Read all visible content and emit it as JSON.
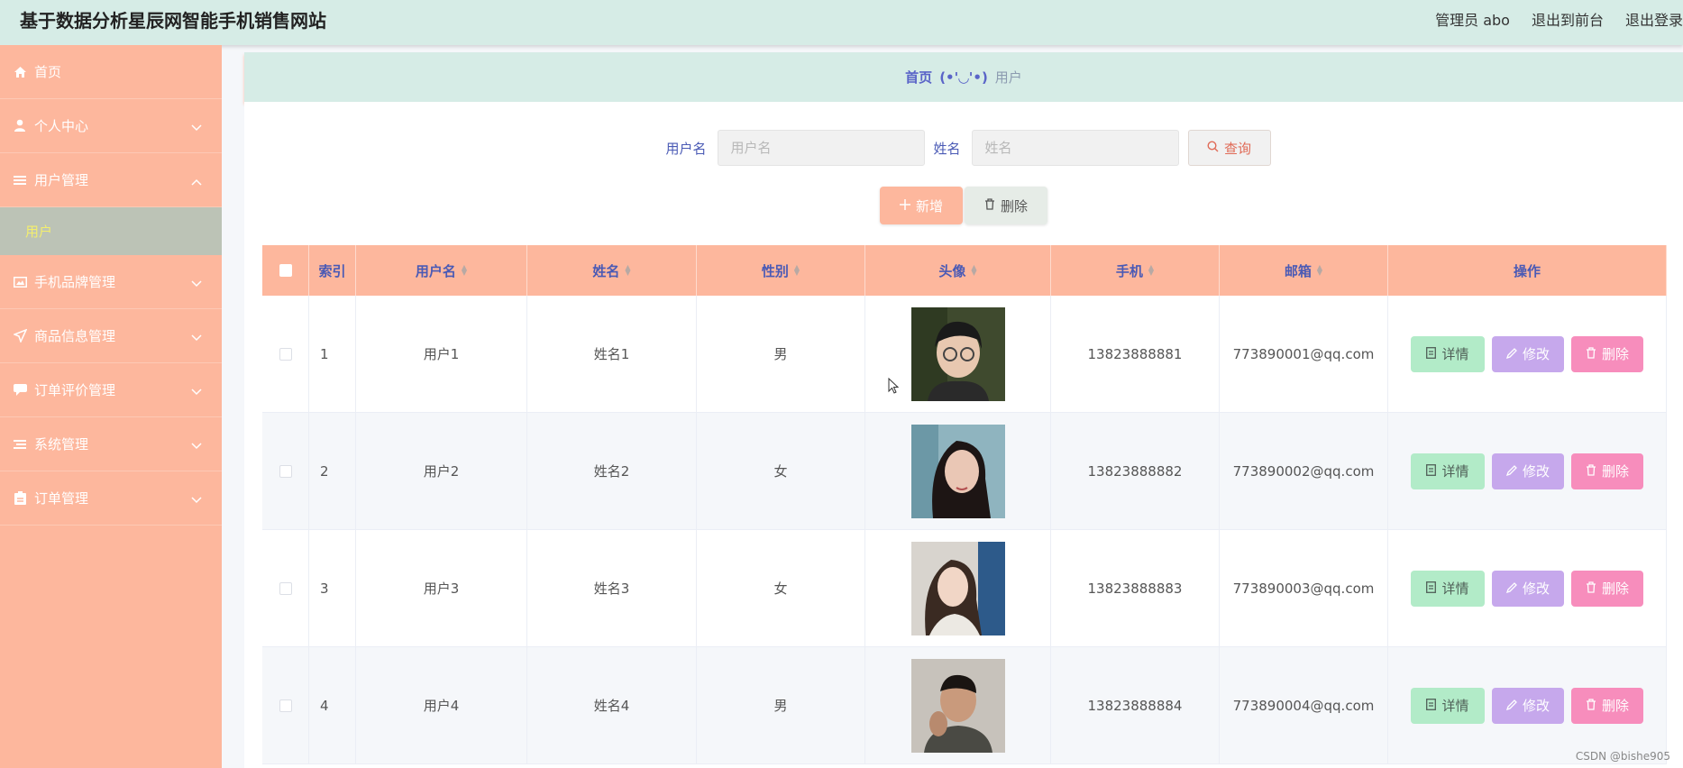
{
  "header": {
    "title": "基于数据分析星辰网智能手机销售网站",
    "user_label": "管理员 abo",
    "to_front": "退出到前台",
    "logout": "退出登录"
  },
  "sidebar": {
    "items": [
      {
        "label": "首页",
        "icon": "home-icon"
      },
      {
        "label": "个人中心",
        "icon": "user-icon"
      },
      {
        "label": "用户管理",
        "icon": "list-icon"
      },
      {
        "label": "手机品牌管理",
        "icon": "picture-icon"
      },
      {
        "label": "商品信息管理",
        "icon": "send-icon"
      },
      {
        "label": "订单评价管理",
        "icon": "chat-icon"
      },
      {
        "label": "系统管理",
        "icon": "menu-icon"
      },
      {
        "label": "订单管理",
        "icon": "clipboard-icon"
      }
    ],
    "sub_active": "用户",
    "background": "#fdb79d",
    "sub_background": "#bcc3b6"
  },
  "breadcrumb": {
    "home": "首页",
    "separator": "(•'◡'•)",
    "current": "用户"
  },
  "search": {
    "username_label": "用户名",
    "username_placeholder": "用户名",
    "name_label": "姓名",
    "name_placeholder": "姓名",
    "query_label": "查询"
  },
  "actions": {
    "add_label": "新增",
    "delete_label": "删除"
  },
  "table": {
    "headers": [
      "索引",
      "用户名",
      "姓名",
      "性别",
      "头像",
      "手机",
      "邮箱",
      "操作"
    ],
    "rows": [
      {
        "index": "1",
        "username": "用户1",
        "name": "姓名1",
        "sex": "男",
        "phone": "13823888881",
        "email": "773890001@qq.com"
      },
      {
        "index": "2",
        "username": "用户2",
        "name": "姓名2",
        "sex": "女",
        "phone": "13823888882",
        "email": "773890002@qq.com"
      },
      {
        "index": "3",
        "username": "用户3",
        "name": "姓名3",
        "sex": "女",
        "phone": "13823888883",
        "email": "773890003@qq.com"
      },
      {
        "index": "4",
        "username": "用户4",
        "name": "姓名4",
        "sex": "男",
        "phone": "13823888884",
        "email": "773890004@qq.com"
      }
    ],
    "op_detail": "详情",
    "op_edit": "修改",
    "op_delete": "删除"
  },
  "watermark": "CSDN @bishe905"
}
